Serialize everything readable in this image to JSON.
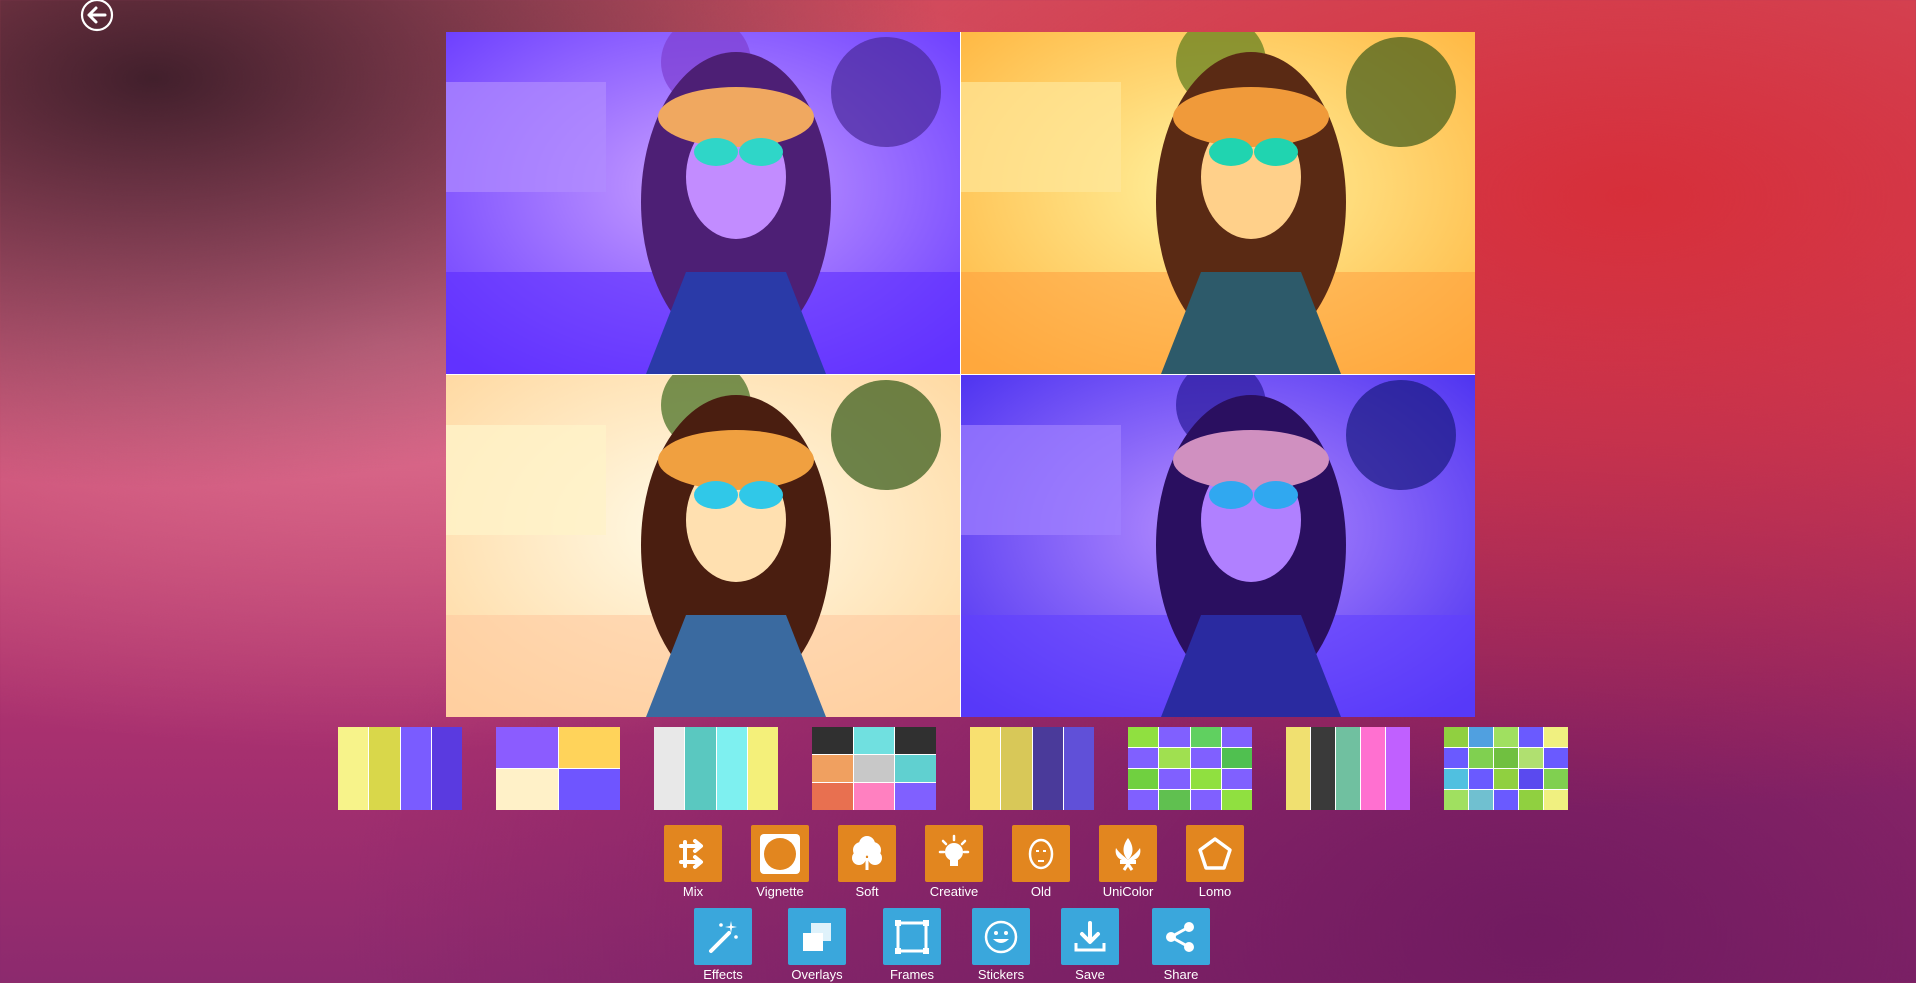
{
  "colors": {
    "effect_button": "#e2861f",
    "action_button": "#3aa7dc",
    "tile_purple": "#8b5cff",
    "tile_yellow": "#ffd35a",
    "tile_white_warm": "#fff1c8",
    "tile_violet": "#6f55ff"
  },
  "header": {
    "back_icon": "arrow-left-circle-icon"
  },
  "collage": {
    "tiles": [
      {
        "filter": "purple"
      },
      {
        "filter": "yellow"
      },
      {
        "filter": "warm-white"
      },
      {
        "filter": "violet"
      }
    ]
  },
  "thumbnails": [
    {
      "icon": "collage-preset-1"
    },
    {
      "icon": "collage-preset-2"
    },
    {
      "icon": "collage-preset-3"
    },
    {
      "icon": "collage-preset-4"
    },
    {
      "icon": "collage-preset-5"
    },
    {
      "icon": "collage-preset-6"
    },
    {
      "icon": "collage-preset-7"
    },
    {
      "icon": "collage-preset-8"
    }
  ],
  "effects": [
    {
      "label": "Mix",
      "icon": "shuffle-icon"
    },
    {
      "label": "Vignette",
      "icon": "vignette-icon"
    },
    {
      "label": "Soft",
      "icon": "cotton-icon"
    },
    {
      "label": "Creative",
      "icon": "lightbulb-icon"
    },
    {
      "label": "Old",
      "icon": "old-face-icon"
    },
    {
      "label": "UniColor",
      "icon": "fleur-de-lis-icon"
    },
    {
      "label": "Lomo",
      "icon": "pentagon-icon"
    }
  ],
  "actions": [
    {
      "label": "Effects",
      "icon": "magic-wand-icon"
    },
    {
      "label": "Overlays",
      "icon": "overlays-icon"
    },
    {
      "label": "Frames",
      "icon": "frame-icon"
    },
    {
      "label": "Stickers",
      "icon": "smiley-icon"
    },
    {
      "label": "Save",
      "icon": "download-icon"
    },
    {
      "label": "Share",
      "icon": "share-icon"
    }
  ]
}
